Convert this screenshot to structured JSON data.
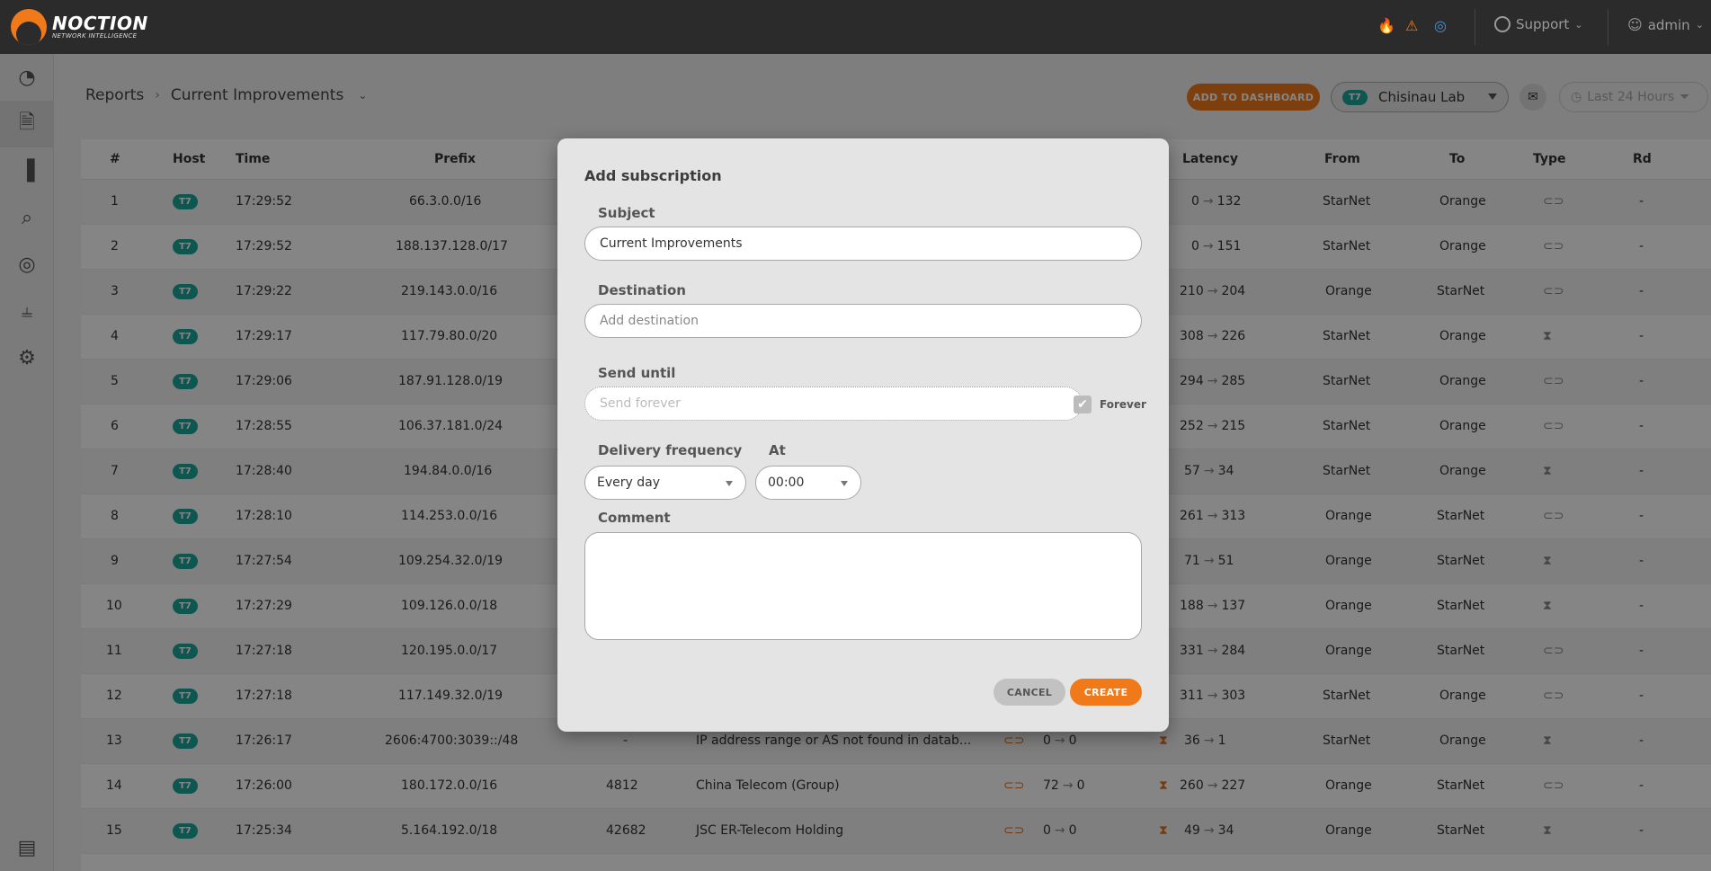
{
  "app": {
    "logo_name": "NOCTION",
    "logo_sub": "NETWORK INTELLIGENCE"
  },
  "topbar": {
    "support_label": "Support",
    "user_label": "admin",
    "icons": [
      "fire-icon",
      "warning-icon",
      "chat-icon"
    ],
    "colors": {
      "fire": "#f05a28",
      "warning": "#f07a1a",
      "chat": "#4a90d9"
    }
  },
  "sidebar": {
    "items": [
      "dashboard-icon",
      "reports-icon",
      "charts-icon",
      "search-icon",
      "globe-icon",
      "sliders-icon",
      "gear-icon",
      "report-problem-icon"
    ]
  },
  "header": {
    "breadcrumb_root": "Reports",
    "breadcrumb_current": "Current Improvements",
    "add_to_dashboard": "ADD TO DASHBOARD",
    "site_badge": "T7",
    "site_name": "Chisinau Lab",
    "time_filter": "Last 24 Hours"
  },
  "table": {
    "columns": [
      "#",
      "Host",
      "Time",
      "Prefix",
      "Latency",
      "From",
      "To",
      "Type",
      "Rd"
    ],
    "rows": [
      {
        "n": "1",
        "host": "T7",
        "time": "17:29:52",
        "prefix": "66.3.0.0/16",
        "lat_from": "0",
        "lat_to": "132",
        "from": "StarNet",
        "to": "Orange",
        "type": "reroute",
        "rd": "-"
      },
      {
        "n": "2",
        "host": "T7",
        "time": "17:29:52",
        "prefix": "188.137.128.0/17",
        "lat_from": "0",
        "lat_to": "151",
        "from": "StarNet",
        "to": "Orange",
        "type": "reroute",
        "rd": "-"
      },
      {
        "n": "3",
        "host": "T7",
        "time": "17:29:22",
        "prefix": "219.143.0.0/16",
        "lat_from": "210",
        "lat_to": "204",
        "from": "Orange",
        "to": "StarNet",
        "type": "reroute",
        "rd": "-"
      },
      {
        "n": "4",
        "host": "T7",
        "time": "17:29:17",
        "prefix": "117.79.80.0/20",
        "lat_from": "308",
        "lat_to": "226",
        "from": "StarNet",
        "to": "Orange",
        "type": "latency",
        "rd": "-"
      },
      {
        "n": "5",
        "host": "T7",
        "time": "17:29:06",
        "prefix": "187.91.128.0/19",
        "lat_from": "294",
        "lat_to": "285",
        "from": "StarNet",
        "to": "Orange",
        "type": "reroute",
        "rd": "-"
      },
      {
        "n": "6",
        "host": "T7",
        "time": "17:28:55",
        "prefix": "106.37.181.0/24",
        "lat_from": "252",
        "lat_to": "215",
        "from": "StarNet",
        "to": "Orange",
        "type": "reroute",
        "rd": "-"
      },
      {
        "n": "7",
        "host": "T7",
        "time": "17:28:40",
        "prefix": "194.84.0.0/16",
        "lat_from": "57",
        "lat_to": "34",
        "from": "StarNet",
        "to": "Orange",
        "type": "latency",
        "rd": "-"
      },
      {
        "n": "8",
        "host": "T7",
        "time": "17:28:10",
        "prefix": "114.253.0.0/16",
        "lat_from": "261",
        "lat_to": "313",
        "from": "Orange",
        "to": "StarNet",
        "type": "reroute",
        "rd": "-"
      },
      {
        "n": "9",
        "host": "T7",
        "time": "17:27:54",
        "prefix": "109.254.32.0/19",
        "lat_from": "71",
        "lat_to": "51",
        "from": "Orange",
        "to": "StarNet",
        "type": "latency",
        "rd": "-"
      },
      {
        "n": "10",
        "host": "T7",
        "time": "17:27:29",
        "prefix": "109.126.0.0/18",
        "lat_from": "188",
        "lat_to": "137",
        "from": "Orange",
        "to": "StarNet",
        "type": "latency",
        "rd": "-"
      },
      {
        "n": "11",
        "host": "T7",
        "time": "17:27:18",
        "prefix": "120.195.0.0/17",
        "lat_from": "331",
        "lat_to": "284",
        "from": "Orange",
        "to": "StarNet",
        "type": "reroute",
        "rd": "-"
      },
      {
        "n": "12",
        "host": "T7",
        "time": "17:27:18",
        "prefix": "117.149.32.0/19",
        "lat_from": "311",
        "lat_to": "303",
        "from": "StarNet",
        "to": "Orange",
        "type": "reroute",
        "rd": "-"
      },
      {
        "n": "13",
        "host": "T7",
        "time": "17:26:17",
        "prefix": "2606:4700:3039::/48",
        "asn": "-",
        "asname": "IP address range or AS not found in datab...",
        "loss_from": "0",
        "loss_to": "0",
        "lat_from": "36",
        "lat_to": "1",
        "from": "StarNet",
        "to": "Orange",
        "type": "latency",
        "rd": "-"
      },
      {
        "n": "14",
        "host": "T7",
        "time": "17:26:00",
        "prefix": "180.172.0.0/16",
        "asn": "4812",
        "asname": "China Telecom (Group)",
        "loss_from": "72",
        "loss_to": "0",
        "lat_from": "260",
        "lat_to": "227",
        "from": "Orange",
        "to": "StarNet",
        "type": "reroute",
        "rd": "-"
      },
      {
        "n": "15",
        "host": "T7",
        "time": "17:25:34",
        "prefix": "5.164.192.0/18",
        "asn": "42682",
        "asname": "JSC ER-Telecom Holding",
        "loss_from": "0",
        "loss_to": "0",
        "lat_from": "49",
        "lat_to": "34",
        "from": "Orange",
        "to": "StarNet",
        "type": "latency",
        "rd": "-"
      }
    ]
  },
  "modal": {
    "title": "Add subscription",
    "subject_label": "Subject",
    "subject_value": "Current Improvements",
    "destination_label": "Destination",
    "destination_placeholder": "Add destination",
    "send_until_label": "Send until",
    "send_until_placeholder": "Send forever",
    "forever_label": "Forever",
    "forever_checked": true,
    "frequency_label": "Delivery frequency",
    "frequency_value": "Every day",
    "at_label": "At",
    "at_value": "00:00",
    "comment_label": "Comment",
    "comment_value": "",
    "cancel_label": "CANCEL",
    "create_label": "CREATE"
  }
}
